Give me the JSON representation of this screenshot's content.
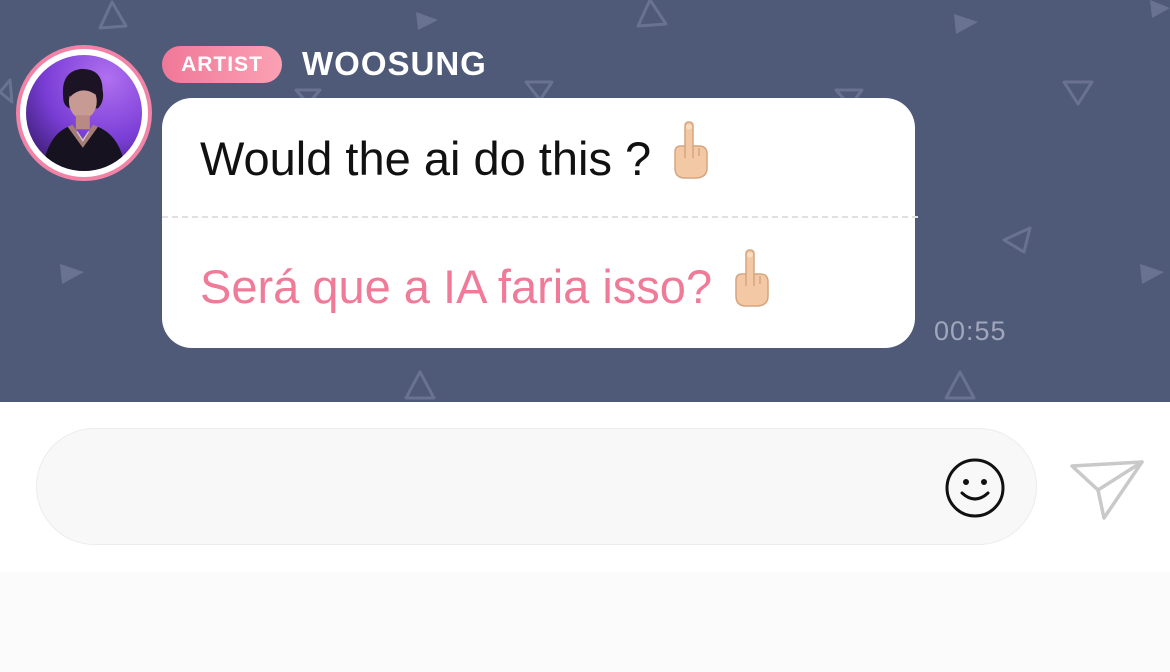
{
  "header": {
    "badge_label": "ARTIST",
    "sender_name": "WOOSUNG"
  },
  "message": {
    "original_text": "Would the ai do this ?",
    "translated_text": "Será que a IA faria isso?",
    "emoji": "middle-finger-emoji",
    "timestamp": "00:55"
  },
  "composer": {
    "input_value": "",
    "placeholder": "",
    "emoji_icon": "smiley-face-icon",
    "send_icon": "paper-plane-icon"
  },
  "colors": {
    "chat_background": "#4f5a78",
    "accent_pink": "#f07b99",
    "avatar_ring": "#f282a6",
    "bubble": "#ffffff",
    "timestamp": "#a0a7bb"
  }
}
